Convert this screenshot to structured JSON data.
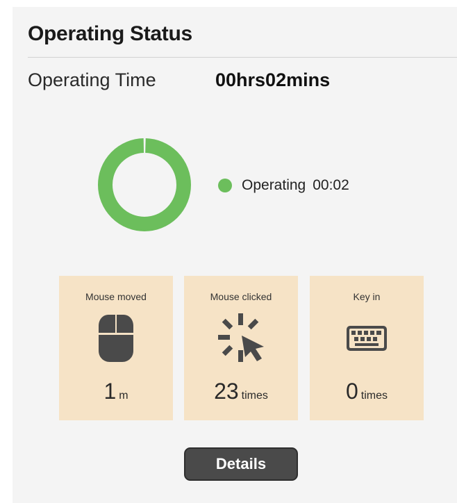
{
  "panel": {
    "title": "Operating Status",
    "operating_time_label": "Operating Time",
    "operating_time_value": "00hrs02mins"
  },
  "status_chart": {
    "type": "donut",
    "segments": [
      {
        "label": "Operating",
        "value_text": "00:02",
        "fraction": 1.0,
        "color": "#6cbe5c"
      }
    ]
  },
  "cards": [
    {
      "label": "Mouse moved",
      "icon": "mouse-icon",
      "value": "1",
      "unit": "m"
    },
    {
      "label": "Mouse clicked",
      "icon": "click-icon",
      "value": "23",
      "unit": "times"
    },
    {
      "label": "Key in",
      "icon": "keyboard-icon",
      "value": "0",
      "unit": "times"
    }
  ],
  "details_button": {
    "label": "Details"
  },
  "colors": {
    "panel_background": "#f4f4f4",
    "card_background": "#f6e3c6",
    "operating_green": "#6cbe5c",
    "icon_dark": "#4a4a4a",
    "button_background": "#4a4a4a"
  }
}
